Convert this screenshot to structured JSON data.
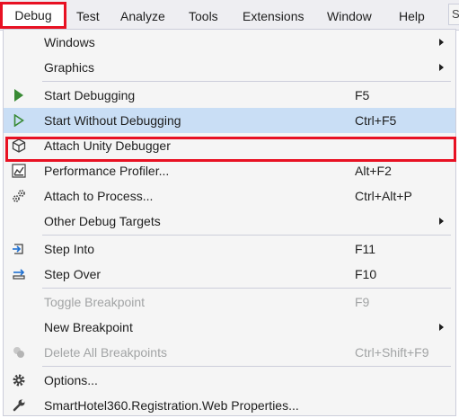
{
  "menubar": {
    "items": [
      "Debug",
      "Test",
      "Analyze",
      "Tools",
      "Extensions",
      "Window",
      "Help"
    ],
    "search_partial": "S"
  },
  "debug_menu": {
    "items": [
      {
        "label": "Windows",
        "shortcut": "",
        "submenu": true,
        "icon": "",
        "disabled": false
      },
      {
        "label": "Graphics",
        "shortcut": "",
        "submenu": true,
        "icon": "",
        "disabled": false
      },
      {
        "label": "Start Debugging",
        "shortcut": "F5",
        "submenu": false,
        "icon": "play-filled-icon",
        "disabled": false
      },
      {
        "label": "Start Without Debugging",
        "shortcut": "Ctrl+F5",
        "submenu": false,
        "icon": "play-outline-icon",
        "disabled": false,
        "highlighted": true
      },
      {
        "label": "Attach Unity Debugger",
        "shortcut": "",
        "submenu": false,
        "icon": "unity-cube-icon",
        "disabled": false
      },
      {
        "label": "Performance Profiler...",
        "shortcut": "Alt+F2",
        "submenu": false,
        "icon": "profiler-chart-icon",
        "disabled": false
      },
      {
        "label": "Attach to Process...",
        "shortcut": "Ctrl+Alt+P",
        "submenu": false,
        "icon": "gears-icon",
        "disabled": false
      },
      {
        "label": "Other Debug Targets",
        "shortcut": "",
        "submenu": true,
        "icon": "",
        "disabled": false
      },
      {
        "label": "Step Into",
        "shortcut": "F11",
        "submenu": false,
        "icon": "step-into-icon",
        "disabled": false
      },
      {
        "label": "Step Over",
        "shortcut": "F10",
        "submenu": false,
        "icon": "step-over-icon",
        "disabled": false
      },
      {
        "label": "Toggle Breakpoint",
        "shortcut": "F9",
        "submenu": false,
        "icon": "",
        "disabled": true
      },
      {
        "label": "New Breakpoint",
        "shortcut": "",
        "submenu": true,
        "icon": "",
        "disabled": false
      },
      {
        "label": "Delete All Breakpoints",
        "shortcut": "Ctrl+Shift+F9",
        "submenu": false,
        "icon": "delete-breakpoints-icon",
        "disabled": true
      },
      {
        "label": "Options...",
        "shortcut": "",
        "submenu": false,
        "icon": "gear-icon",
        "disabled": false
      },
      {
        "label": "SmartHotel360.Registration.Web Properties...",
        "shortcut": "",
        "submenu": false,
        "icon": "wrench-icon",
        "disabled": false
      }
    ]
  },
  "colors": {
    "highlight_bg": "#c9def5",
    "callout_red": "#e81123",
    "play_green": "#388a34",
    "disabled_text": "#a2a4a5"
  }
}
